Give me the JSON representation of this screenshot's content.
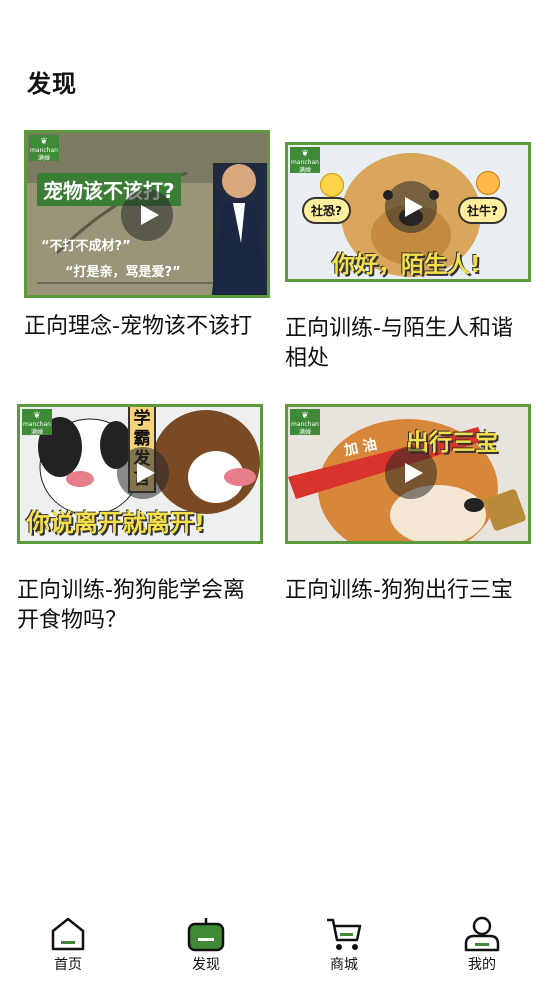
{
  "header": {
    "title": "发现"
  },
  "videos": [
    {
      "title": "正向理念-宠物该不该打",
      "brand": "manchan",
      "brand_sub": "满婵",
      "overlay": {
        "headline": "宠物该不该打?",
        "line1": "“不打不成材?”",
        "line2": "“打是亲，骂是爱?”"
      }
    },
    {
      "title": "正向训练-与陌生人和谐相处",
      "brand": "manchan",
      "brand_sub": "满婵",
      "overlay": {
        "bubble_left": "社恐?",
        "bubble_right": "社牛?",
        "headline": "你好，陌生人!"
      }
    },
    {
      "title": "正向训练-狗狗能学会离开食物吗？",
      "brand": "manchan",
      "brand_sub": "满婵",
      "overlay": {
        "tag": "学霸发言",
        "headline": "你说离开就离开!"
      }
    },
    {
      "title": "正向训练-狗狗出行三宝",
      "brand": "manchan",
      "brand_sub": "满婵",
      "overlay": {
        "headband": "加 油",
        "headline": "出行三宝"
      }
    }
  ],
  "tabbar": {
    "items": [
      {
        "label": "首页",
        "icon": "home-icon",
        "active": false
      },
      {
        "label": "发现",
        "icon": "discover-tv-icon",
        "active": true
      },
      {
        "label": "商城",
        "icon": "cart-icon",
        "active": false
      },
      {
        "label": "我的",
        "icon": "profile-icon",
        "active": false
      }
    ]
  },
  "colors": {
    "accent": "#5c9a3c",
    "text": "#111111",
    "headline_yellow": "#f6e04a",
    "brand_green": "#3e8a36"
  }
}
